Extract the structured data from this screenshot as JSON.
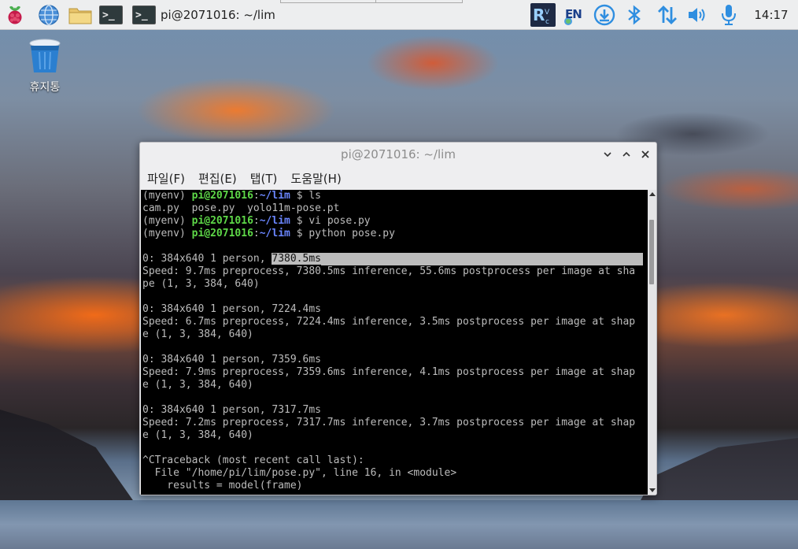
{
  "panel": {
    "launchers": {
      "menu_icon": "raspberry-pi-icon",
      "browser_icon": "globe-icon",
      "files_icon": "folder-icon",
      "terminal_icon": "terminal-icon",
      "terminal_glyph": ">_"
    },
    "taskbar_window": {
      "glyph": ">_",
      "label": "pi@2071016: ~/lim"
    },
    "tray": {
      "input_method": "EN",
      "clock": "14:17"
    }
  },
  "desktop": {
    "trash_label": "휴지통"
  },
  "window": {
    "title": "pi@2071016: ~/lim",
    "menu": [
      "파일(F)",
      "편집(E)",
      "탭(T)",
      "도움말(H)"
    ],
    "terminal": {
      "prompt": {
        "env": "(myenv) ",
        "user": "pi@2071016",
        "colon": ":",
        "path": "~/lim",
        "dollar": " $ "
      },
      "commands": {
        "c1": "ls",
        "ls_output": "cam.py  pose.py  yolo11m-pose.pt",
        "c2": "vi pose.py",
        "c3": "python pose.py"
      },
      "results": [
        {
          "detect": "0: 384x640 1 person, ",
          "time": "7380.5ms",
          "speed1": "Speed: 9.7ms preprocess, 7380.5ms inference, 55.6ms postprocess per image at sha",
          "speed2": "pe (1, 3, 384, 640)"
        },
        {
          "detect": "0: 384x640 1 person, ",
          "time": "7224.4ms",
          "speed1": "Speed: 6.7ms preprocess, 7224.4ms inference, 3.5ms postprocess per image at shap",
          "speed2": "e (1, 3, 384, 640)"
        },
        {
          "detect": "0: 384x640 1 person, ",
          "time": "7359.6ms",
          "speed1": "Speed: 7.9ms preprocess, 7359.6ms inference, 4.1ms postprocess per image at shap",
          "speed2": "e (1, 3, 384, 640)"
        },
        {
          "detect": "0: 384x640 1 person, ",
          "time": "7317.7ms",
          "speed1": "Speed: 7.2ms preprocess, 7317.7ms inference, 3.7ms postprocess per image at shap",
          "speed2": "e (1, 3, 384, 640)"
        }
      ],
      "traceback": {
        "t1": "^CTraceback (most recent call last):",
        "t2": "  File \"/home/pi/lim/pose.py\", line 16, in <module>",
        "t3": "    results = model(frame)"
      }
    }
  },
  "colors": {
    "panel_bg": "#edeeef",
    "terminal_bg": "#000000",
    "prompt_user": "#5ed848",
    "prompt_path": "#6a86ff",
    "selection": "#bcbcbc"
  }
}
